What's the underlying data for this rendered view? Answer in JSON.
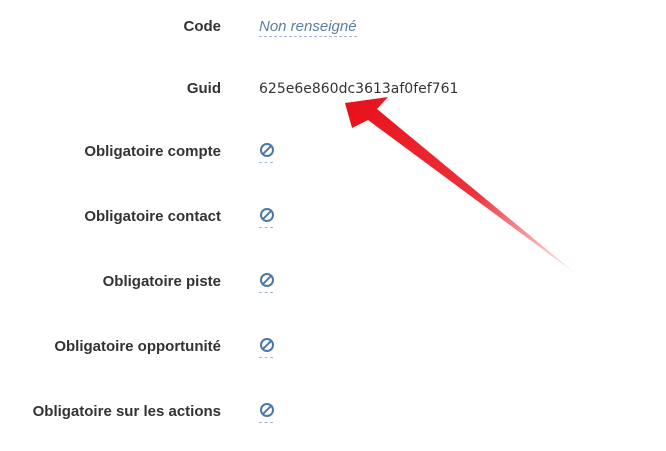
{
  "fields": [
    {
      "label": "Code",
      "value": "Non renseigné",
      "kind": "empty"
    },
    {
      "label": "Guid",
      "value": "625e6e860dc3613af0fef761",
      "kind": "text"
    },
    {
      "label": "Obligatoire compte",
      "value_icon": "ban-icon",
      "kind": "bool"
    },
    {
      "label": "Obligatoire contact",
      "value_icon": "ban-icon",
      "kind": "bool"
    },
    {
      "label": "Obligatoire piste",
      "value_icon": "ban-icon",
      "kind": "bool"
    },
    {
      "label": "Obligatoire opportunité",
      "value_icon": "ban-icon",
      "kind": "bool"
    },
    {
      "label": "Obligatoire sur les actions",
      "value_icon": "ban-icon",
      "kind": "bool"
    }
  ],
  "colors": {
    "label": "#333333",
    "link": "#5a7fa6",
    "icon": "#4a79a8",
    "arrow": "#e8101a"
  },
  "annotation_icon": "red-arrow-icon"
}
